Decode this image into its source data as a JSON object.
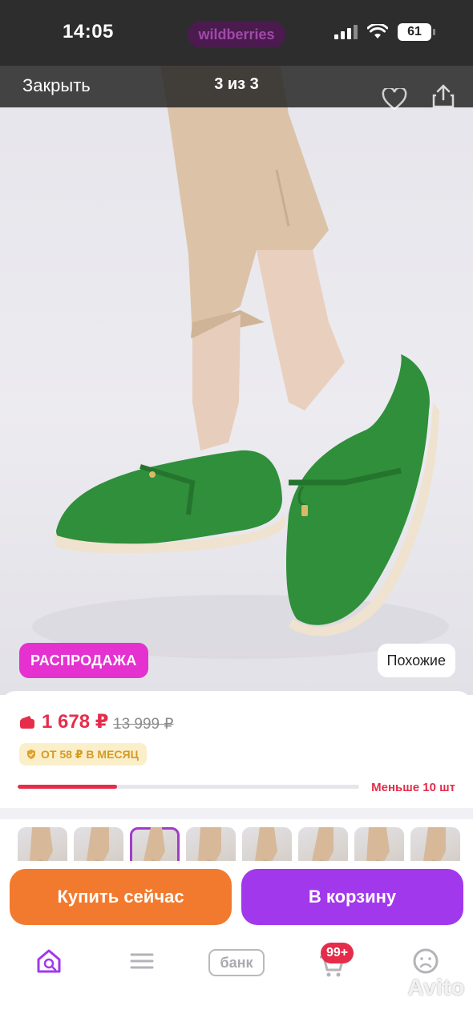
{
  "status_bar": {
    "time": "14:05",
    "app_pill": "wildberries",
    "battery": "61"
  },
  "viewer": {
    "close_label": "Закрыть",
    "counter": "3 из 3"
  },
  "photo": {
    "sale_badge": "РАСПРОДАЖА",
    "similar_label": "Похожие"
  },
  "price": {
    "current": "1 678 ₽",
    "old": "13 999 ₽",
    "installment": "ОТ 58 ₽ В МЕСЯЦ",
    "stock_label": "Меньше 10 шт",
    "stock_fraction": 0.29
  },
  "thumbnails": {
    "count": 8,
    "active_index": 2
  },
  "actions": {
    "buy_now_label": "Купить сейчас",
    "add_to_cart_label": "В корзину"
  },
  "bottom_nav": {
    "bank_label": "банк",
    "cart_badge": "99+"
  },
  "watermark": "Avito",
  "colors": {
    "accent_purple": "#a238ec",
    "accent_orange": "#f27a2e",
    "price_red": "#e52d4b",
    "sale_pink": "#e531cf",
    "shoe_green": "#2f8f3a"
  },
  "icons": [
    "wallet-icon",
    "shield-icon",
    "heart-icon",
    "share-icon",
    "home-search-icon",
    "menu-icon",
    "cart-icon",
    "profile-icon",
    "back-icon"
  ]
}
